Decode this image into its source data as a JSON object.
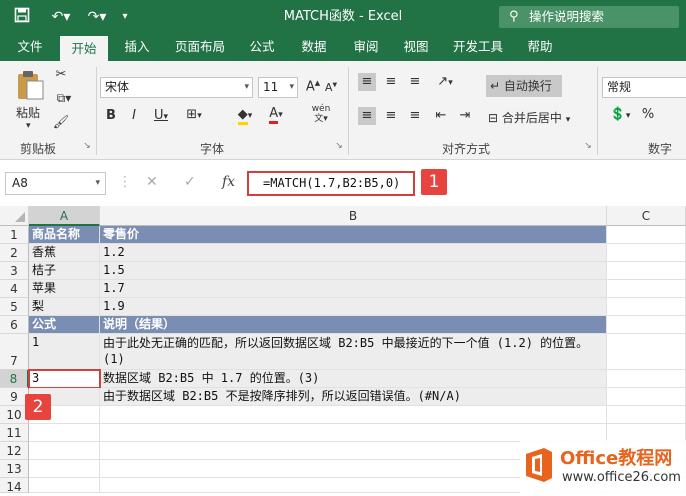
{
  "titlebar": {
    "title": "MATCH函数  -  Excel",
    "search_placeholder": "操作说明搜索"
  },
  "tabs": [
    "文件",
    "开始",
    "插入",
    "页面布局",
    "公式",
    "数据",
    "审阅",
    "视图",
    "开发工具",
    "帮助"
  ],
  "active_tab": "开始",
  "ribbon": {
    "paste": "粘贴",
    "clipboard_label": "剪贴板",
    "font_name": "宋体",
    "font_size": "11",
    "font_label": "字体",
    "bold": "B",
    "italic": "I",
    "underline": "U",
    "font_grow": "A",
    "font_shrink": "A",
    "wen": "wén",
    "wrap_text": "自动换行",
    "merge_center": "合并后居中",
    "alignment_label": "对齐方式",
    "number_format": "常规",
    "percent": "%",
    "number_label": "数字"
  },
  "formula_bar": {
    "name_box": "A8",
    "formula": "=MATCH(1.7,B2:B5,0)",
    "fx": "fx"
  },
  "callouts": [
    "1",
    "2"
  ],
  "columns": [
    "A",
    "B",
    "C"
  ],
  "rows": [
    "1",
    "2",
    "3",
    "4",
    "5",
    "6",
    "7",
    "8",
    "9",
    "10",
    "11",
    "12",
    "13",
    "14"
  ],
  "cells": {
    "A1": "商品名称",
    "B1": "零售价",
    "A2": "香蕉",
    "B2": "1.2",
    "A3": "桔子",
    "B3": "1.5",
    "A4": "苹果",
    "B4": "1.7",
    "A5": "梨",
    "B5": "1.9",
    "A6": "公式",
    "B6": "说明（结果）",
    "A7": "1",
    "B7": "由于此处无正确的匹配，所以返回数据区域 B2:B5 中最接近的下一个值 (1.2) 的位置。(1)",
    "A8": "3",
    "B8": "数据区域 B2:B5 中 1.7 的位置。(3)",
    "B9": "由于数据区域 B2:B5 不是按降序排列，所以返回错误值。(#N/A)"
  },
  "watermark": {
    "brand": "Office教程网",
    "url": "www.office26.com"
  },
  "colors": {
    "excel_green": "#217346",
    "header_fill": "#7a8db2",
    "callout_red": "#e8443f",
    "watermark_orange": "#e8641e"
  }
}
